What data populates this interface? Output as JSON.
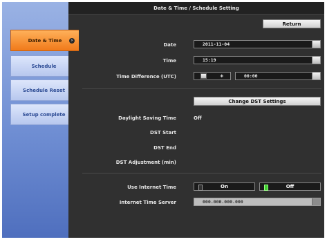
{
  "window": {
    "title": "Date & Time / Schedule Setting"
  },
  "sidebar": {
    "items": [
      {
        "label": "Date & Time",
        "active": true
      },
      {
        "label": "Schedule",
        "active": false
      },
      {
        "label": "Schedule Reset",
        "active": false
      },
      {
        "label": "Setup complete",
        "active": false
      }
    ]
  },
  "toolbar": {
    "return_label": "Return"
  },
  "form": {
    "date_label": "Date",
    "date_value": "2011-11-04",
    "time_label": "Time",
    "time_value": "15:19",
    "time_difference_label": "Time Difference (UTC)",
    "time_difference_sign": "+",
    "time_difference_value": "00:00",
    "change_dst_label": "Change DST Settings",
    "dst_label": "Daylight Saving Time",
    "dst_value": "Off",
    "dst_start_label": "DST Start",
    "dst_end_label": "DST End",
    "dst_adjustment_label": "DST Adjustment (min)",
    "use_internet_time_label": "Use Internet Time",
    "internet_time_on_label": "On",
    "internet_time_off_label": "Off",
    "internet_time_selected": "Off",
    "internet_time_server_label": "Internet Time Server",
    "internet_time_server_value": "000.000.000.000"
  },
  "colors": {
    "active_tab": "#f07a1a",
    "sidebar_bg": "#6f8ed3",
    "panel_bg": "#303030",
    "toggle_on": "#3ecf2f"
  }
}
